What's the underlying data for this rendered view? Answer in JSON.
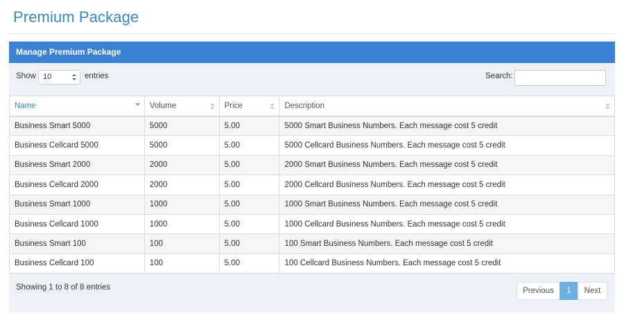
{
  "page": {
    "title": "Premium Package"
  },
  "panel": {
    "header": "Manage Premium Package"
  },
  "controls": {
    "show_label": "Show",
    "length_value": "10",
    "entries_label": "entries",
    "search_label": "Search:",
    "search_value": ""
  },
  "table": {
    "columns": [
      "Name",
      "Volume",
      "Price",
      "Description"
    ],
    "sorted_column": "Name",
    "rows": [
      [
        "Business Smart 5000",
        "5000",
        "5.00",
        "5000 Smart Business Numbers. Each message cost 5 credit"
      ],
      [
        "Business Cellcard 5000",
        "5000",
        "5.00",
        "5000 Cellcard Business Numbers. Each message cost 5 credit"
      ],
      [
        "Business Smart 2000",
        "2000",
        "5.00",
        "2000 Smart Business Numbers. Each message cost 5 credit"
      ],
      [
        "Business Cellcard 2000",
        "2000",
        "5.00",
        "2000 Cellcard Business Numbers. Each message cost 5 credit"
      ],
      [
        "Business Smart 1000",
        "1000",
        "5.00",
        "1000 Smart Business Numbers. Each message cost 5 credit"
      ],
      [
        "Business Cellcard 1000",
        "1000",
        "5.00",
        "1000 Cellcard Business Numbers. Each message cost 5 credit"
      ],
      [
        "Business Smart 100",
        "100",
        "5.00",
        "100 Smart Business Numbers. Each message cost 5 credit"
      ],
      [
        "Business Cellcard 100",
        "100",
        "5.00",
        "100 Cellcard Business Numbers. Each message cost 5 credit"
      ]
    ]
  },
  "footer": {
    "info": "Showing 1 to 8 of 8 entries"
  },
  "pagination": {
    "previous": "Previous",
    "current": "1",
    "next": "Next"
  },
  "colors": {
    "accent": "#3c82d4",
    "title": "#3a87c6",
    "active_page": "#6aaee4"
  },
  "icons": {
    "sort": "sort-both-icon",
    "sorted": "sort-desc-icon",
    "select": "select-arrows-icon"
  }
}
